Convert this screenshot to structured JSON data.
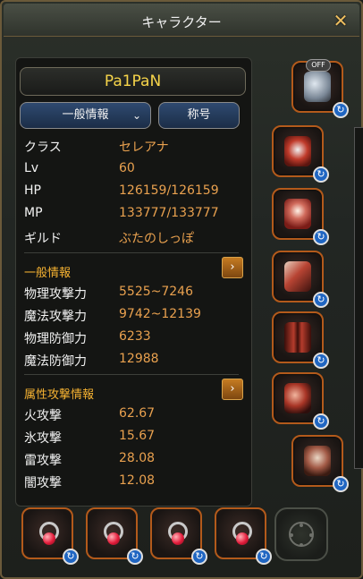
{
  "window": {
    "title": "キャラクター",
    "close_glyph": "✕"
  },
  "character": {
    "name": "Pa1PaN"
  },
  "buttons": {
    "general_info": "一般情報",
    "title": "称号",
    "chevron": "⌄"
  },
  "profile": [
    {
      "label": "クラス",
      "value": "セレアナ"
    },
    {
      "label": "Lv",
      "value": "60"
    },
    {
      "label": "HP",
      "value": "126159/126159"
    },
    {
      "label": "MP",
      "value": "133777/133777"
    },
    {
      "label": "ギルド",
      "value": "ぶたのしっぽ"
    }
  ],
  "general_section": {
    "header": "一般情報",
    "expand_glyph": "›",
    "stats": [
      {
        "label": "物理攻撃力",
        "value": "5525~7246"
      },
      {
        "label": "魔法攻撃力",
        "value": "9742~12139"
      },
      {
        "label": "物理防御力",
        "value": "6233"
      },
      {
        "label": "魔法防御力",
        "value": "12988"
      }
    ]
  },
  "element_section": {
    "header": "属性攻撃情報",
    "expand_glyph": "›",
    "stats": [
      {
        "label": "火攻撃",
        "value": "62.67"
      },
      {
        "label": "氷攻撃",
        "value": "15.67"
      },
      {
        "label": "雷攻撃",
        "value": "28.08"
      },
      {
        "label": "闇攻撃",
        "value": "12.08"
      }
    ]
  },
  "equipment": {
    "off_badge": "OFF",
    "swap_glyph": "↻"
  },
  "colors": {
    "name": "#f6d44a",
    "value": "#e9a14f",
    "section_header": "#f6b232",
    "slot_border": "#b35a1b",
    "button_blue": "#2f4a70"
  }
}
